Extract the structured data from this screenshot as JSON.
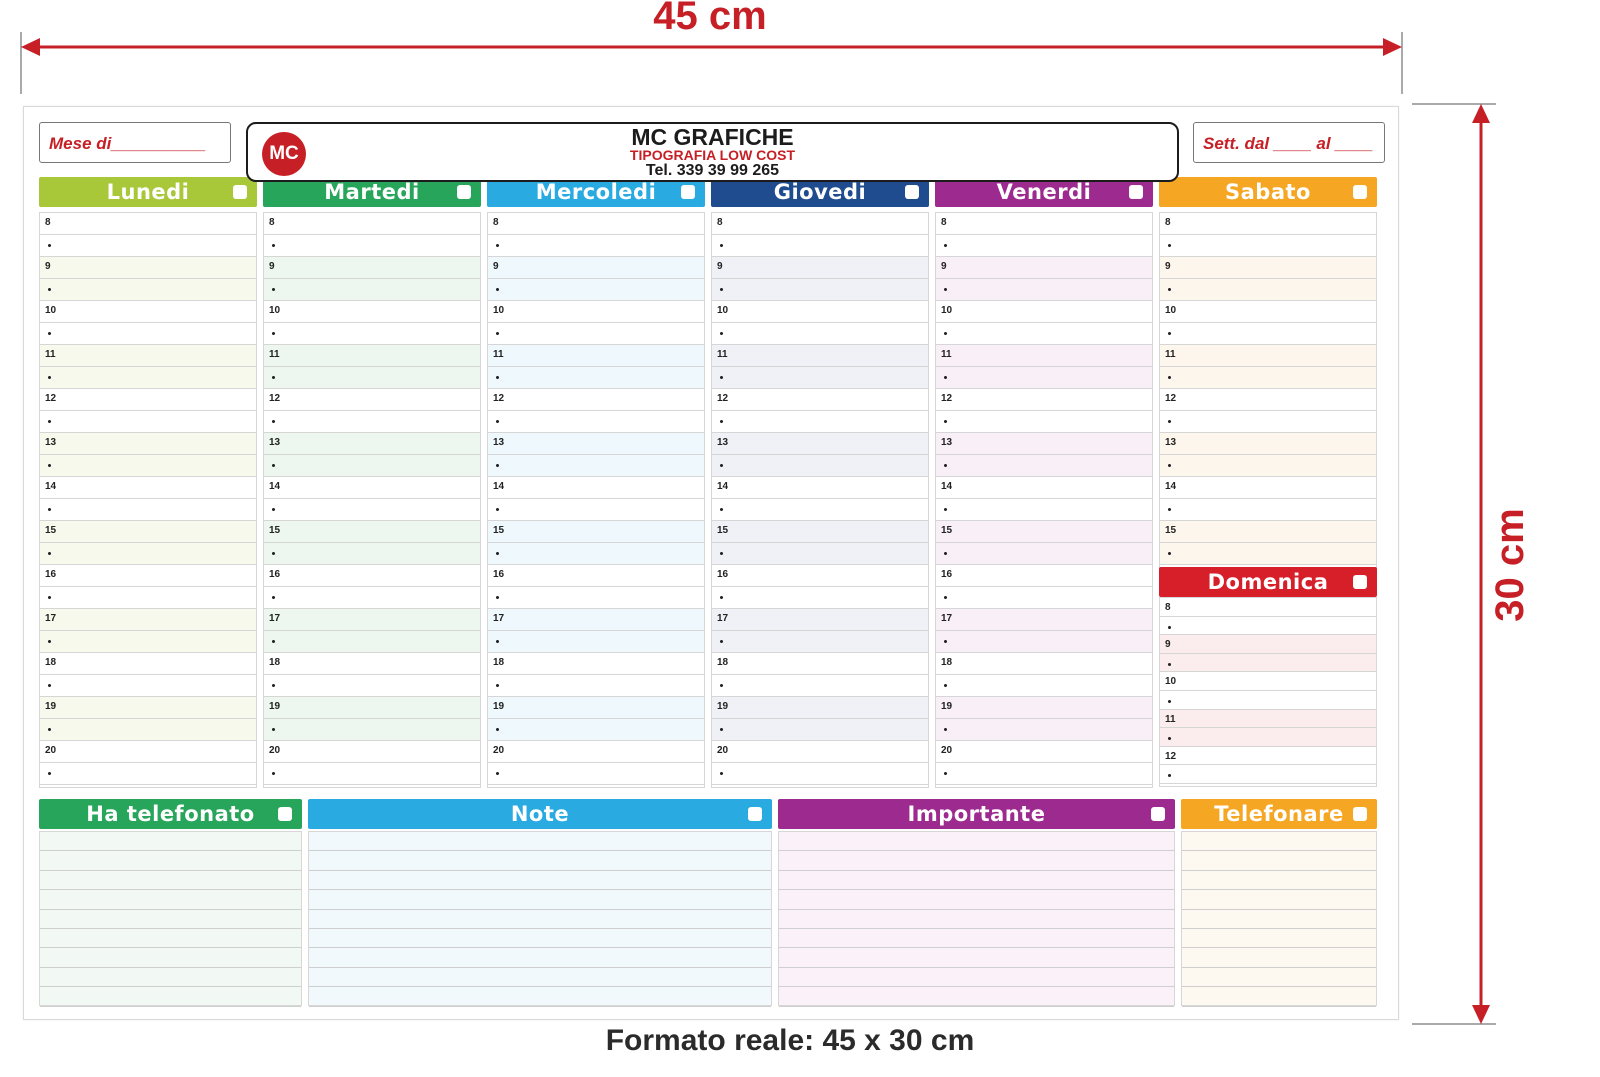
{
  "dimensions": {
    "width_label": "45 cm",
    "height_label": "30 cm",
    "color": "#c62026"
  },
  "caption": "Formato reale: 45 x 30 cm",
  "header": {
    "month_label": "Mese di__________",
    "week_label": "Sett. dal ____ al ____",
    "logo_text": "MC",
    "company": "MC GRAFICHE",
    "tagline": "TIPOGRAFIA LOW COST",
    "phone": "Tel. 339 39 99 265"
  },
  "hours": [
    "8",
    "9",
    "10",
    "11",
    "12",
    "13",
    "14",
    "15",
    "16",
    "17",
    "18",
    "19",
    "20"
  ],
  "days": [
    {
      "name": "Lunedi",
      "color": "#a8c83a",
      "tint": "#f6f9ec"
    },
    {
      "name": "Martedi",
      "color": "#27a55a",
      "tint": "#edf7f0"
    },
    {
      "name": "Mercoledi",
      "color": "#29abe2",
      "tint": "#eef8fd"
    },
    {
      "name": "Giovedi",
      "color": "#1f4b8f",
      "tint": "#f0f1f6"
    },
    {
      "name": "Venerdi",
      "color": "#9c2a8f",
      "tint": "#f9eff7"
    }
  ],
  "saturday": {
    "name": "Sabato",
    "color": "#f5a623",
    "tint": "#fdf6ec",
    "hours": [
      "8",
      "9",
      "10",
      "11",
      "12",
      "13",
      "14",
      "15"
    ]
  },
  "sunday": {
    "name": "Domenica",
    "color": "#d71f2a",
    "tint": "#fbecee",
    "hours": [
      "8",
      "9",
      "10",
      "11",
      "12"
    ]
  },
  "bottom_sections": [
    {
      "name": "Ha telefonato",
      "color": "#27a55a",
      "tint": "#f2f8f4"
    },
    {
      "name": "Note",
      "color": "#29abe2",
      "tint": "#f1f9fd"
    },
    {
      "name": "Importante",
      "color": "#9c2a8f",
      "tint": "#faf2f8"
    },
    {
      "name": "Telefonare",
      "color": "#f5a623",
      "tint": "#fdf9f1"
    }
  ]
}
